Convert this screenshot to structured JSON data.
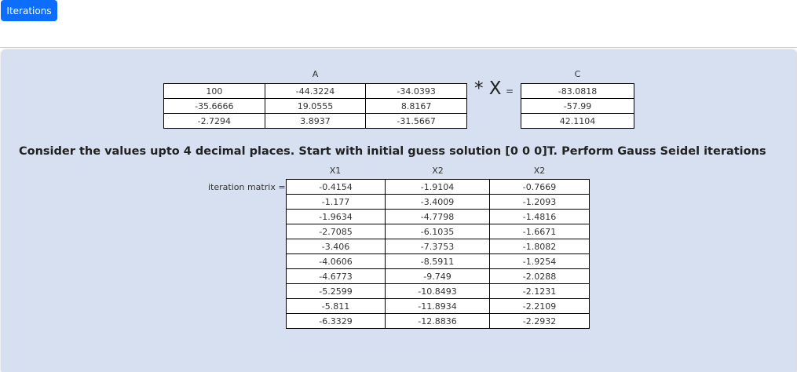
{
  "toolbar": {
    "iterations_label": "Iterations"
  },
  "system": {
    "matrix_a_label": "A",
    "matrix_a": [
      [
        "100",
        "-44.3224",
        "-34.0393"
      ],
      [
        "-35.6666",
        "19.0555",
        "8.8167"
      ],
      [
        "-2.7294",
        "3.8937",
        "-31.5667"
      ]
    ],
    "times_x": "* X",
    "equals": "=",
    "vector_c_label": "C",
    "vector_c": [
      "-83.0818",
      "-57.99",
      "42.1104"
    ]
  },
  "question": "Consider the values upto 4 decimal places. Start with initial guess solution [0 0 0]T. Perform Gauss Seidel iterations",
  "iteration": {
    "label": "iteration matrix =",
    "headers": [
      "X1",
      "X2",
      "X2"
    ],
    "rows": [
      [
        "-0.4154",
        "-1.9104",
        "-0.7669"
      ],
      [
        "-1.177",
        "-3.4009",
        "-1.2093"
      ],
      [
        "-1.9634",
        "-4.7798",
        "-1.4816"
      ],
      [
        "-2.7085",
        "-6.1035",
        "-1.6671"
      ],
      [
        "-3.406",
        "-7.3753",
        "-1.8082"
      ],
      [
        "-4.0606",
        "-8.5911",
        "-1.9254"
      ],
      [
        "-4.6773",
        "-9.749",
        "-2.0288"
      ],
      [
        "-5.2599",
        "-10.8493",
        "-2.1231"
      ],
      [
        "-5.811",
        "-11.8934",
        "-2.2109"
      ],
      [
        "-6.3329",
        "-12.8836",
        "-2.2932"
      ]
    ]
  }
}
